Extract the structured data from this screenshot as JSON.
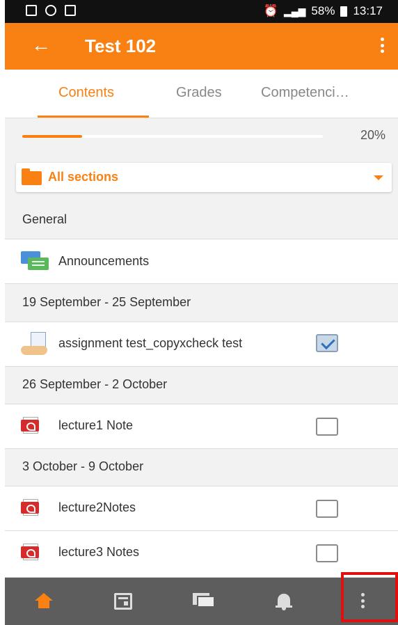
{
  "status_bar": {
    "battery": "58%",
    "time": "13:17"
  },
  "app_bar": {
    "title": "Test 102"
  },
  "tabs": [
    {
      "label": "Contents",
      "active": true
    },
    {
      "label": "Grades",
      "active": false
    },
    {
      "label": "Competenci…",
      "active": false
    }
  ],
  "progress": {
    "value": 0.2,
    "label": "20%"
  },
  "section_selector": {
    "selected": "All sections"
  },
  "sections": [
    {
      "title": "General",
      "items": [
        {
          "label": "Announcements",
          "icon": "forum-icon",
          "has_checkbox": false
        }
      ]
    },
    {
      "title": "19 September - 25 September",
      "items": [
        {
          "label": "assignment test_copyxcheck test",
          "icon": "assignment-icon",
          "has_checkbox": true,
          "checked": true
        }
      ]
    },
    {
      "title": "26 September - 2 October",
      "items": [
        {
          "label": "lecture1 Note",
          "icon": "pdf-icon",
          "has_checkbox": true,
          "checked": false
        }
      ]
    },
    {
      "title": "3 October - 9 October",
      "items": [
        {
          "label": "lecture2Notes",
          "icon": "pdf-icon",
          "has_checkbox": true,
          "checked": false
        },
        {
          "label": "lecture3 Notes",
          "icon": "pdf-icon",
          "has_checkbox": true,
          "checked": false
        }
      ]
    }
  ],
  "bottom_nav": [
    {
      "icon": "home-icon",
      "active": true
    },
    {
      "icon": "calendar-icon",
      "active": false
    },
    {
      "icon": "messages-icon",
      "active": false
    },
    {
      "icon": "bell-icon",
      "active": false
    },
    {
      "icon": "more-vertical-icon",
      "active": false,
      "highlighted": true
    }
  ],
  "colors": {
    "accent": "#f98012",
    "bottom_bar": "#5d5d5d",
    "highlight": "#e01010"
  }
}
